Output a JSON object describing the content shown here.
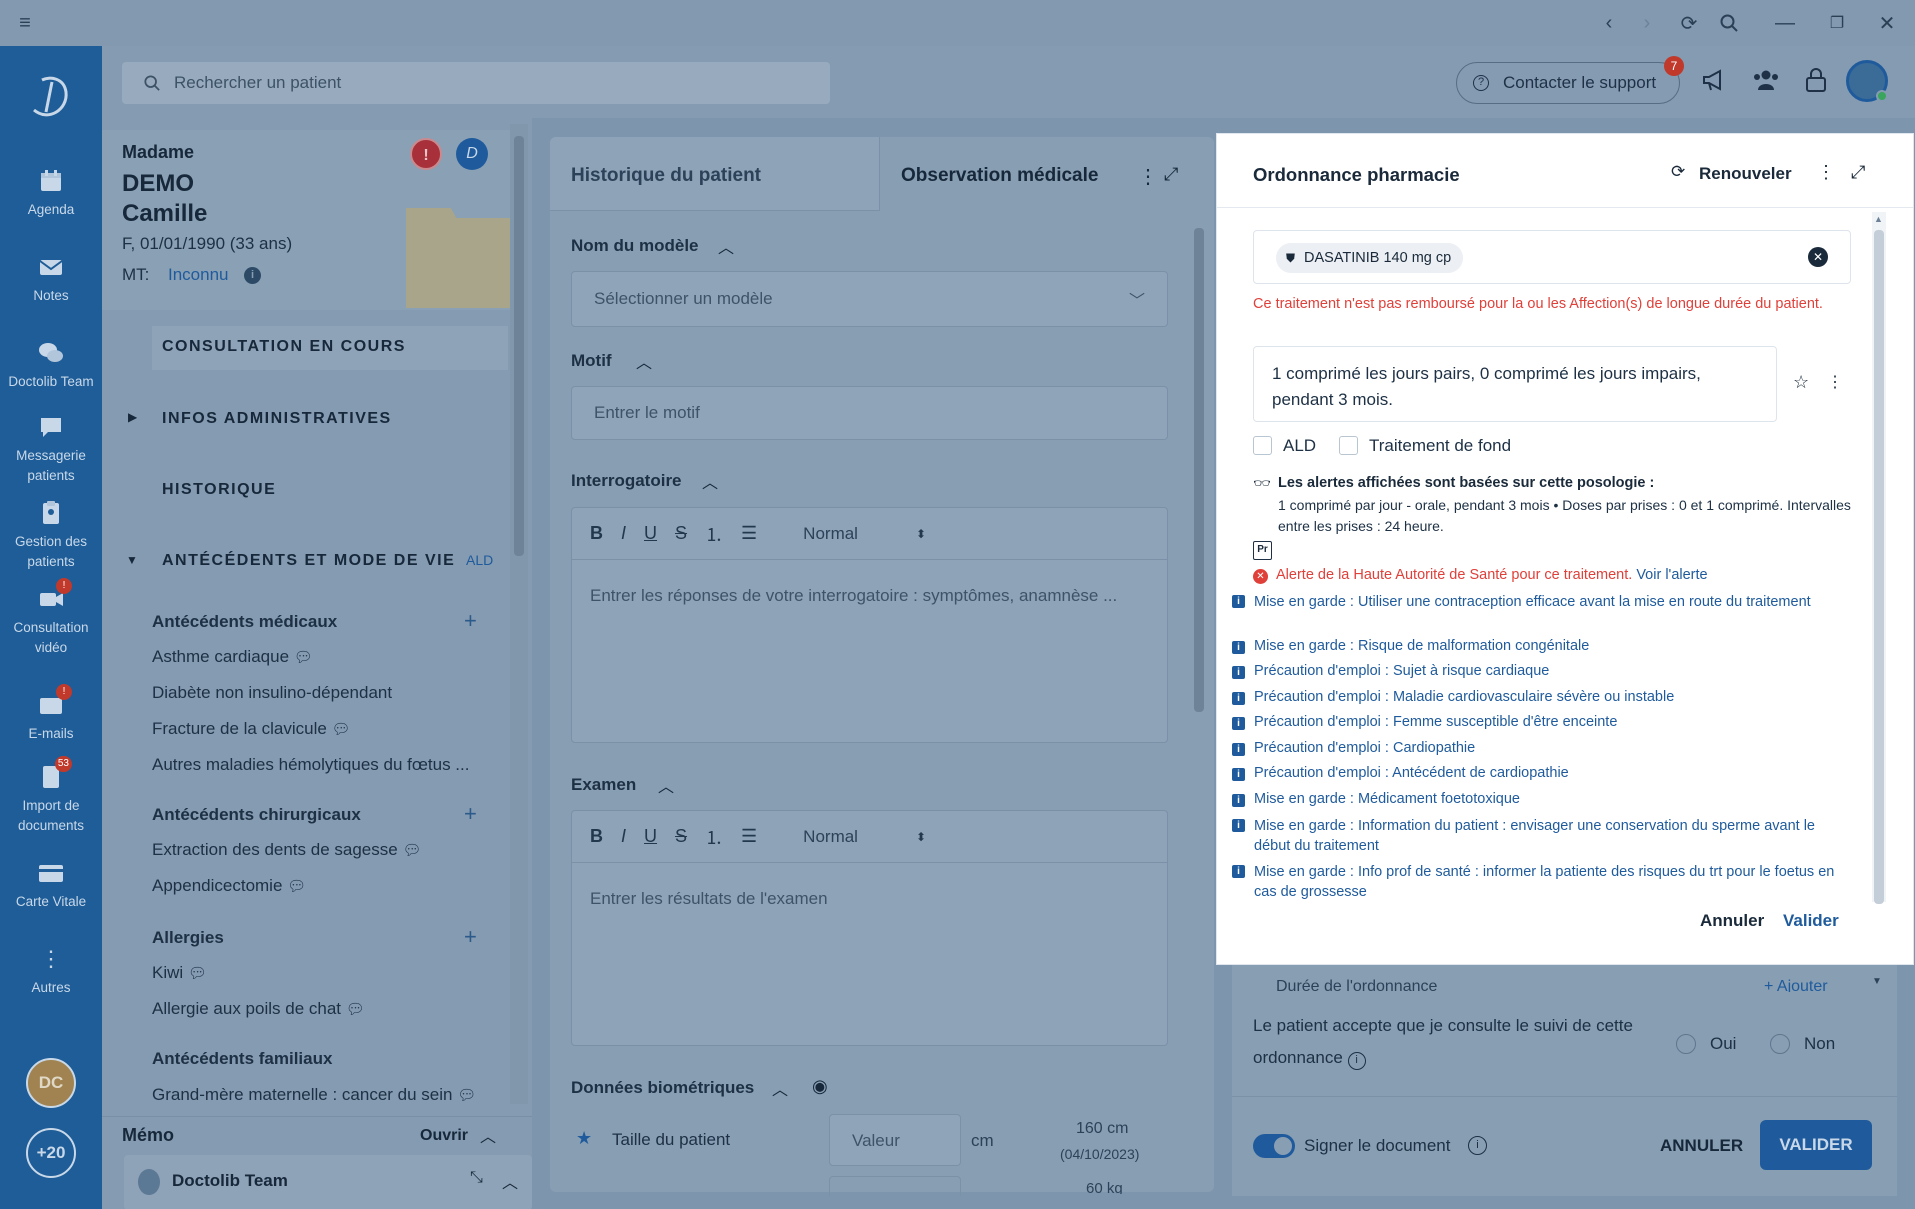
{
  "search": {
    "placeholder": "Rechercher un patient"
  },
  "topbar": {
    "support_label": "Contacter le support",
    "support_badge": "7"
  },
  "nav": {
    "items": [
      {
        "label": "Agenda"
      },
      {
        "label": "Notes"
      },
      {
        "label": "Doctolib Team"
      },
      {
        "label": "Messagerie patients"
      },
      {
        "label": "Gestion des patients"
      },
      {
        "label": "Consultation vidéo",
        "badge": "!"
      },
      {
        "label": "E-mails",
        "badge": "!"
      },
      {
        "label": "Import de documents",
        "badge": "53"
      },
      {
        "label": "Carte Vitale"
      },
      {
        "label": "Autres"
      }
    ],
    "avatar_initials": "DC",
    "more_count": "+20"
  },
  "patient": {
    "civility": "Madame",
    "last_name": "DEMO",
    "first_name": "Camille",
    "info": "F, 01/01/1990 (33 ans)",
    "mt_label": "MT:",
    "mt_value": "Inconnu"
  },
  "sections": {
    "consultation": "CONSULTATION EN COURS",
    "infos_admin": "INFOS ADMINISTRATIVES",
    "historique": "HISTORIQUE",
    "antecedents": "ANTÉCÉDENTS ET MODE DE VIE",
    "ald_tag": "ALD"
  },
  "antecedents": {
    "medicaux_title": "Antécédents médicaux",
    "medicaux": [
      "Asthme cardiaque",
      "Diabète non insulino-dépendant",
      "Fracture de la clavicule",
      "Autres maladies hémolytiques du fœtus ..."
    ],
    "chirurgicaux_title": "Antécédents chirurgicaux",
    "chirurgicaux": [
      "Extraction des dents de sagesse",
      "Appendicectomie"
    ],
    "allergies_title": "Allergies",
    "allergies": [
      "Kiwi",
      "Allergie aux poils de chat"
    ],
    "familiaux_title": "Antécédents familiaux",
    "familiaux": [
      "Grand-mère maternelle : cancer du sein"
    ]
  },
  "memo": {
    "title": "Mémo",
    "open_label": "Ouvrir",
    "team": "Doctolib Team"
  },
  "middle": {
    "tab_history": "Historique du patient",
    "tab_observation": "Observation médicale",
    "model_label": "Nom du modèle",
    "model_placeholder": "Sélectionner un modèle",
    "motif_label": "Motif",
    "motif_placeholder": "Entrer le motif",
    "interrogatoire_label": "Interrogatoire",
    "interrogatoire_placeholder": "Entrer les réponses de votre interrogatoire : symptômes, anamnèse ...",
    "examen_label": "Examen",
    "examen_placeholder": "Entrer les résultats de l'examen",
    "format_normal": "Normal",
    "biometrics_label": "Données biométriques",
    "height_label": "Taille du patient",
    "value_placeholder": "Valeur",
    "unit_cm": "cm",
    "height_last": "160 cm",
    "height_date": "(04/10/2023)",
    "weight_last": "60 kg"
  },
  "rightpanel": {
    "duration_label": "Durée de l'ordonnance",
    "add_label": "Ajouter",
    "consent_text": "Le patient accepte que je consulte le suivi de cette ordonnance",
    "yes": "Oui",
    "no": "Non",
    "sign_label": "Signer le document",
    "cancel": "ANNULER",
    "validate": "VALIDER"
  },
  "modal": {
    "title": "Ordonnance pharmacie",
    "renew_label": "Renouveler",
    "drug": "DASATINIB 140 mg cp",
    "warning": "Ce traitement n'est pas remboursé pour la ou les Affection(s) de longue durée du patient.",
    "posology": "1 comprimé les jours pairs, 0 comprimé les jours impairs, pendant 3 mois.",
    "ald": "ALD",
    "background_treatment": "Traitement de fond",
    "alerts_title": "Les alertes affichées sont basées sur cette posologie :",
    "alerts_detail": "1 comprimé par jour - orale, pendant 3 mois • Doses par prises : 0 et 1 comprimé. Intervalles entre les prises : 24 heure.",
    "pr_badge": "Pr",
    "has_alert": "Alerte de la Haute Autorité de Santé pour ce traitement.",
    "see_alert": "Voir l'alerte",
    "rules": [
      "Mise en garde : Utiliser une contraception efficace avant la mise en route du traitement",
      "Mise en garde : Risque de malformation congénitale",
      "Précaution d'emploi : Sujet à risque cardiaque",
      "Précaution d'emploi : Maladie cardiovasculaire sévère ou instable",
      "Précaution d'emploi : Femme susceptible d'être enceinte",
      "Précaution d'emploi : Cardiopathie",
      "Précaution d'emploi : Antécédent de cardiopathie",
      "Mise en garde : Médicament foetotoxique",
      "Mise en garde : Information du patient : envisager une conservation du sperme avant le début du traitement",
      "Mise en garde : Info prof de santé : informer la patiente des risques du trt pour le foetus en cas de grossesse"
    ],
    "cancel": "Annuler",
    "validate": "Valider"
  },
  "colors": {
    "nav": "#1e5d98",
    "accent": "#1f5b9c",
    "alert": "#e0403a",
    "overlay": "#8299af"
  }
}
